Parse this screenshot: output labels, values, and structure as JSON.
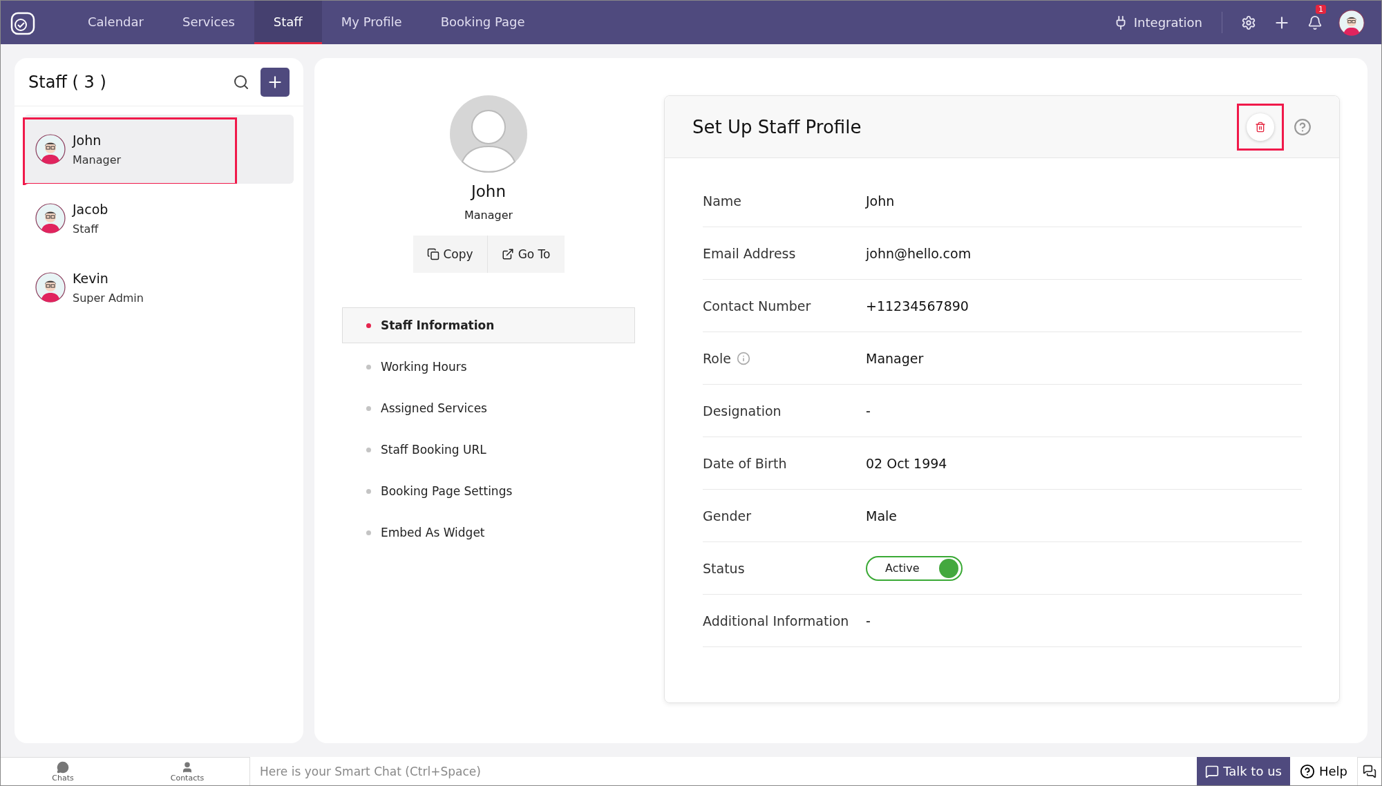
{
  "top_nav": {
    "tabs": [
      {
        "label": "Calendar",
        "selected": false
      },
      {
        "label": "Services",
        "selected": false
      },
      {
        "label": "Staff",
        "selected": true
      },
      {
        "label": "My Profile",
        "selected": false
      },
      {
        "label": "Booking Page",
        "selected": false
      }
    ],
    "integration": "Integration",
    "notification_count": "1"
  },
  "staff_list": {
    "title": "Staff ( 3 )",
    "items": [
      {
        "name": "John",
        "role": "Manager",
        "selected": true,
        "highlighted": true
      },
      {
        "name": "Jacob",
        "role": "Staff",
        "selected": false,
        "highlighted": false
      },
      {
        "name": "Kevin",
        "role": "Super Admin",
        "selected": false,
        "highlighted": false
      }
    ]
  },
  "profile": {
    "name": "John",
    "role": "Manager",
    "actions": [
      "Copy",
      "Go To"
    ],
    "sections": [
      {
        "label": "Staff Information",
        "selected": true
      },
      {
        "label": "Working Hours",
        "selected": false
      },
      {
        "label": "Assigned Services",
        "selected": false
      },
      {
        "label": "Staff Booking URL",
        "selected": false
      },
      {
        "label": "Booking Page Settings",
        "selected": false
      },
      {
        "label": "Embed As Widget",
        "selected": false
      }
    ]
  },
  "card": {
    "title": "Set Up Staff Profile",
    "delete_highlighted": true,
    "fields": [
      {
        "kind": "text",
        "label": "Name",
        "value": "John"
      },
      {
        "kind": "text",
        "label": "Email Address",
        "value": "john@hello.com"
      },
      {
        "kind": "text",
        "label": "Contact Number",
        "value": "+11234567890"
      },
      {
        "kind": "info",
        "label": "Role",
        "value": "Manager"
      },
      {
        "kind": "text",
        "label": "Designation",
        "value": "-"
      },
      {
        "kind": "text",
        "label": "Date of Birth",
        "value": "02 Oct 1994"
      },
      {
        "kind": "text",
        "label": "Gender",
        "value": "Male"
      },
      {
        "kind": "toggle",
        "label": "Status",
        "value": "Active",
        "on": true
      },
      {
        "kind": "text",
        "label": "Additional Information",
        "value": "-"
      }
    ]
  },
  "bottom_bar": {
    "chats": "Chats",
    "contacts": "Contacts",
    "chat_placeholder": "Here is your Smart Chat (Ctrl+Space)",
    "talk": "Talk to us",
    "help": "Help"
  }
}
